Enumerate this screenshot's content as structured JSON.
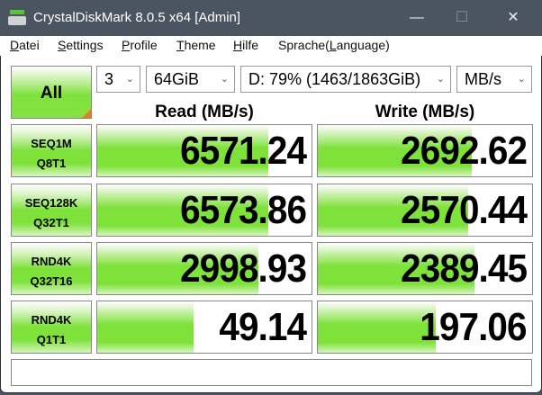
{
  "window": {
    "title": "CrystalDiskMark 8.0.5 x64 [Admin]",
    "minimize": "—",
    "maximize": "☐",
    "close": "✕"
  },
  "menu": [
    {
      "key": "D",
      "rest": "atei"
    },
    {
      "key": "S",
      "rest": "ettings"
    },
    {
      "key": "P",
      "rest": "rofile"
    },
    {
      "key": "T",
      "rest": "heme"
    },
    {
      "key": "H",
      "rest": "ilfe"
    },
    {
      "pre": "Sprache(",
      "key": "L",
      "rest": "anguage)"
    }
  ],
  "controls": {
    "all_label": "All",
    "count": "3",
    "size": "64GiB",
    "drive": "D: 79% (1463/1863GiB)",
    "unit": "MB/s",
    "chevron": "⌄"
  },
  "headers": {
    "read": "Read (MB/s)",
    "write": "Write (MB/s)"
  },
  "rows": [
    {
      "line1": "SEQ1M",
      "line2": "Q8T1",
      "read": "6571.24",
      "write": "2692.62",
      "read_fill": 0.8,
      "write_fill": 0.72
    },
    {
      "line1": "SEQ128K",
      "line2": "Q32T1",
      "read": "6573.86",
      "write": "2570.44",
      "read_fill": 0.8,
      "write_fill": 0.7
    },
    {
      "line1": "RND4K",
      "line2": "Q32T16",
      "read": "2998.93",
      "write": "2389.45",
      "read_fill": 0.75,
      "write_fill": 0.73
    },
    {
      "line1": "RND4K",
      "line2": "Q1T1",
      "read": "49.14",
      "write": "197.06",
      "read_fill": 0.45,
      "write_fill": 0.55
    }
  ],
  "comment": ""
}
